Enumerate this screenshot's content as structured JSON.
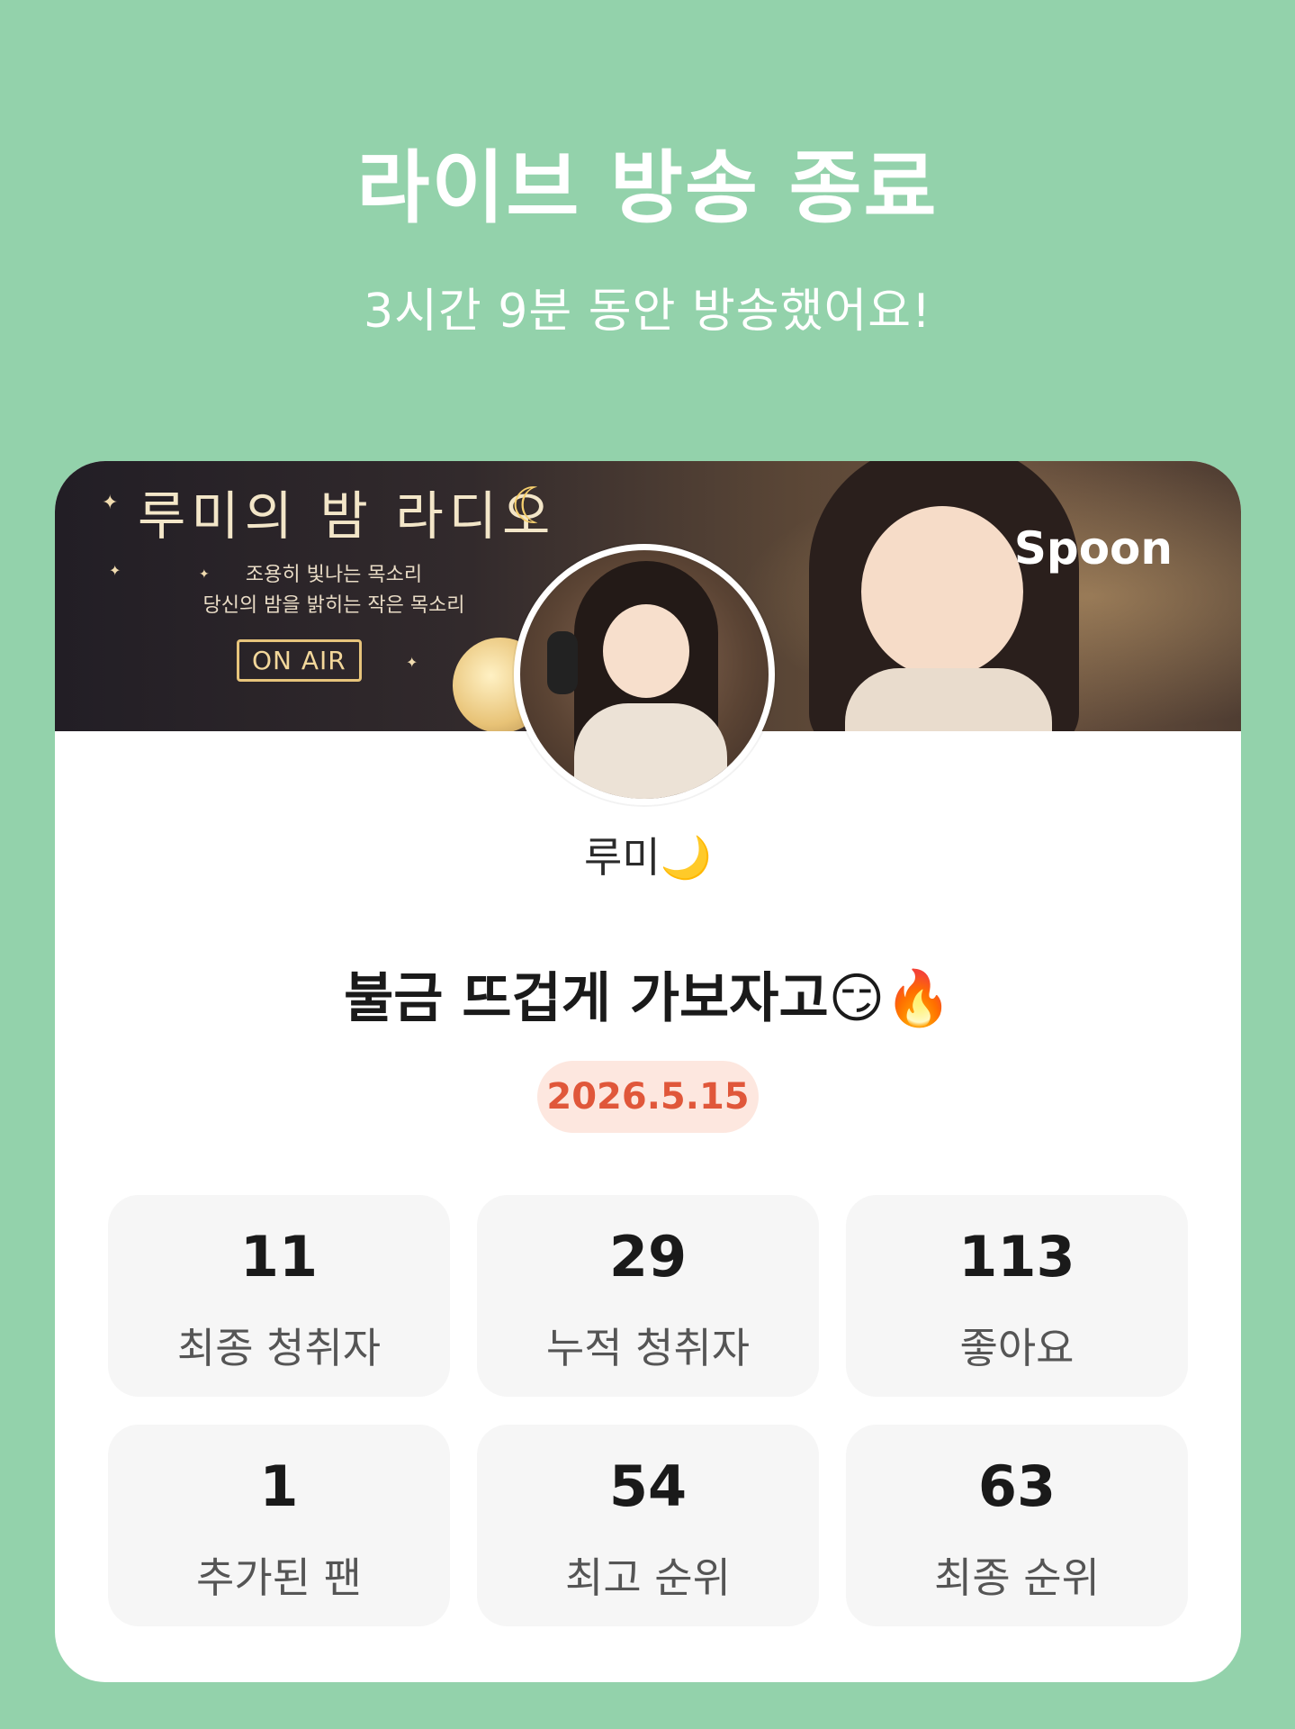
{
  "header": {
    "title": "라이브 방송 종료",
    "subtitle": "3시간 9분 동안 방송했어요!"
  },
  "banner": {
    "title": "루미의 밤 라디오",
    "tagline_1": "조용히 빛나는 목소리",
    "tagline_2": "당신의 밤을 밝히는 작은 목소리",
    "on_air": "ON AIR",
    "brand": "Spoon",
    "moon_icon": "crescent-moon-icon"
  },
  "profile": {
    "nickname": "루미",
    "nickname_emoji": "🌙"
  },
  "broadcast": {
    "title": "불금 뜨겁게 가보자고😏🔥",
    "date": "2026.5.15"
  },
  "stats": [
    {
      "value": "11",
      "label": "최종 청취자"
    },
    {
      "value": "29",
      "label": "누적 청취자"
    },
    {
      "value": "113",
      "label": "좋아요"
    },
    {
      "value": "1",
      "label": "추가된 팬"
    },
    {
      "value": "54",
      "label": "최고 순위"
    },
    {
      "value": "63",
      "label": "최종 순위"
    }
  ],
  "colors": {
    "background": "#93d2ab",
    "card": "#ffffff",
    "date_text": "#e0573a",
    "date_pill": "#fde7df",
    "stat_tile": "#f6f6f6"
  }
}
